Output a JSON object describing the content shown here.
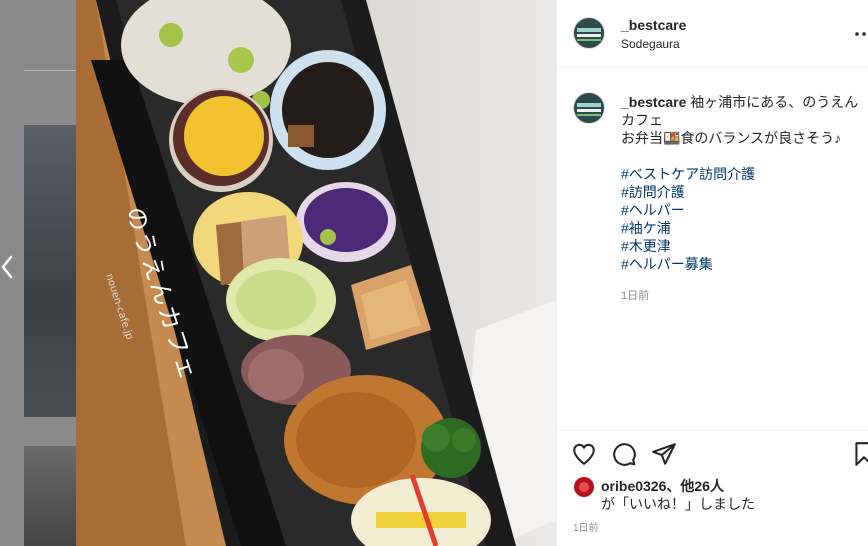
{
  "post": {
    "username": "_bestcare",
    "location": "Sodegaura",
    "caption_user": "_bestcare",
    "caption_line1": " 袖ヶ浦市にある、のうえん",
    "caption_line2": "カフェ",
    "caption_line3": "お弁当🍱食のバランスが良さそう♪",
    "hashtags": [
      "#ベストケア訪問介護",
      "#訪問介護",
      "#ヘルパー",
      "#袖ケ浦",
      "#木更津",
      "#ヘルパー募集"
    ],
    "caption_time": "1日前",
    "likes_line1": "oribe0326、他26人",
    "likes_line2": "が「いいね！」しました",
    "post_time": "1日前"
  },
  "photo": {
    "package_text": "のうえんカフェ",
    "package_url": "nouen-cafe.jp"
  },
  "icons": [
    "chevron-left-icon",
    "more-icon",
    "heart-icon",
    "comment-icon",
    "share-icon",
    "bookmark-icon"
  ],
  "colors": {
    "hashtag": "#00376b",
    "text": "#262626",
    "muted": "#8e8e8e",
    "border": "#efefef"
  }
}
